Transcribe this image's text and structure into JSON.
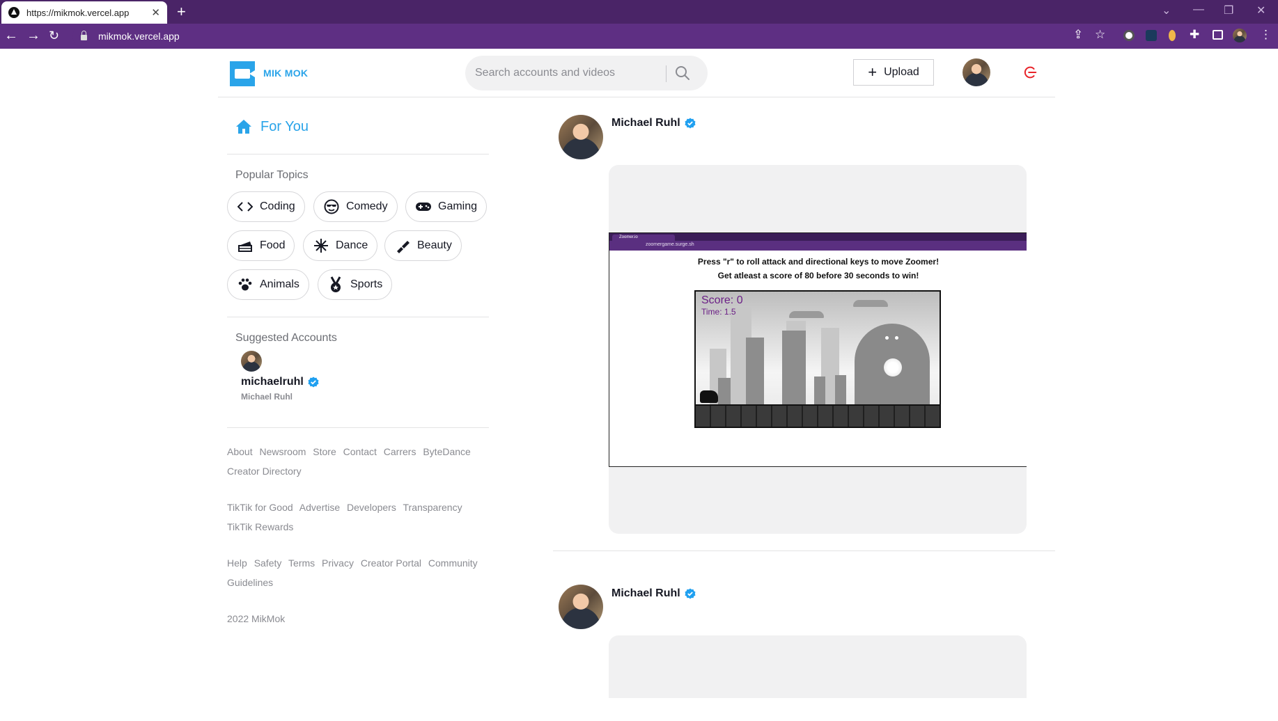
{
  "browser": {
    "tab_title": "https://mikmok.vercel.app",
    "url": "mikmok.vercel.app"
  },
  "header": {
    "logo_text": "MIK MOK",
    "search_placeholder": "Search accounts and videos",
    "upload_label": "Upload"
  },
  "sidebar": {
    "for_you": "For You",
    "popular_topics_heading": "Popular Topics",
    "topics": [
      {
        "label": "Coding",
        "icon": "code-icon"
      },
      {
        "label": "Comedy",
        "icon": "sunglasses-face-icon"
      },
      {
        "label": "Gaming",
        "icon": "gamepad-icon"
      },
      {
        "label": "Food",
        "icon": "cake-icon"
      },
      {
        "label": "Dance",
        "icon": "dance-burst-icon"
      },
      {
        "label": "Beauty",
        "icon": "lipstick-icon"
      },
      {
        "label": "Animals",
        "icon": "paw-icon"
      },
      {
        "label": "Sports",
        "icon": "medal-icon"
      }
    ],
    "suggested_heading": "Suggested Accounts",
    "suggested_account": {
      "username": "michaelruhl",
      "display_name": "Michael Ruhl"
    },
    "footer": {
      "row1": [
        "About",
        "Newsroom",
        "Store",
        "Contact",
        "Carrers",
        "ByteDance",
        "Creator Directory"
      ],
      "row2": [
        "TikTik for Good",
        "Advertise",
        "Developers",
        "Transparency",
        "TikTik Rewards"
      ],
      "row3": [
        "Help",
        "Safety",
        "Terms",
        "Privacy",
        "Creator Portal",
        "Community Guidelines"
      ],
      "copyright": "2022 MikMok"
    }
  },
  "feed": {
    "posts": [
      {
        "author": "Michael Ruhl",
        "video": {
          "mini_tab": "Zoomer.io",
          "mini_url": "zoomergame.surge.sh",
          "instruction_line1": "Press \"r\" to roll attack and directional keys to move Zoomer!",
          "instruction_line2": "Get atleast a score of 80 before 30 seconds to win!",
          "score": "Score: 0",
          "time": "Time: 1.5"
        }
      },
      {
        "author": "Michael Ruhl"
      }
    ]
  },
  "colors": {
    "brand": "#2aa4e9",
    "browser_frame": "#4a2467",
    "verified": "#20a0f0",
    "logout": "#e8242a"
  }
}
